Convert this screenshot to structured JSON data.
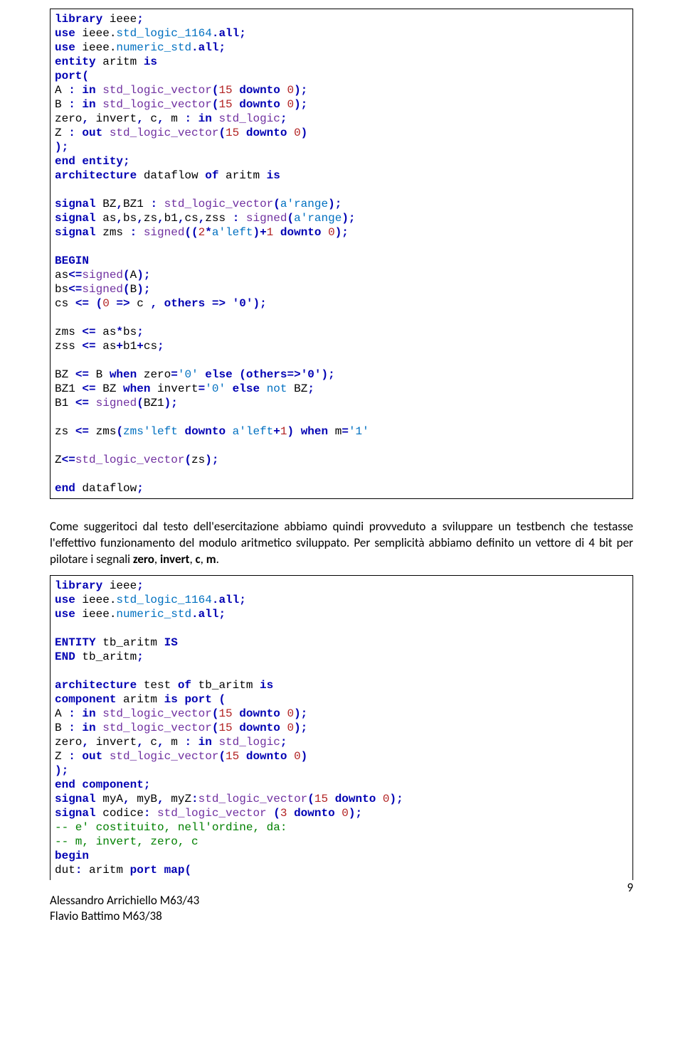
{
  "code1": {
    "l1a": "library",
    "l1b": " ieee",
    "l1c": ";",
    "l2a": "use",
    "l2b": " ieee.",
    "l2c": "std_logic_1164",
    "l2d": ".",
    "l2e": "all",
    "l2f": ";",
    "l3a": "use",
    "l3b": " ieee.",
    "l3c": "numeric_std",
    "l3d": ".",
    "l3e": "all",
    "l3f": ";",
    "l4a": "entity",
    "l4b": " aritm ",
    "l4c": "is",
    "l5a": "port",
    "l5b": "(",
    "l6a": "A ",
    "l6b": ": in ",
    "l6c": "std_logic_vector",
    "l6d": "(",
    "l6e": "15",
    "l6f": " downto ",
    "l6g": "0",
    "l6h": ");",
    "l7a": "B ",
    "l7b": ": in ",
    "l7c": "std_logic_vector",
    "l7d": "(",
    "l7e": "15",
    "l7f": " downto ",
    "l7g": "0",
    "l7h": ");",
    "l8a": "zero",
    "l8b": ", ",
    "l8c": "invert",
    "l8d": ", ",
    "l8e": "c",
    "l8f": ", ",
    "l8g": "m ",
    "l8h": ": in ",
    "l8i": "std_logic",
    "l8j": ";",
    "l9a": "Z ",
    "l9b": ": out ",
    "l9c": "std_logic_vector",
    "l9d": "(",
    "l9e": "15",
    "l9f": " downto ",
    "l9g": "0",
    "l9h": ")",
    "l10a": ");",
    "l11a": "end entity;",
    "l12a": "architecture",
    "l12b": " dataflow ",
    "l12c": "of",
    "l12d": " aritm ",
    "l12e": "is",
    "blank1": "",
    "l13a": "signal",
    "l13b": " BZ",
    "l13c": ",",
    "l13d": "BZ1 ",
    "l13e": ": ",
    "l13f": "std_logic_vector",
    "l13g": "(",
    "l13h": "a'range",
    "l13i": ");",
    "l14a": "signal",
    "l14b": " as",
    "l14c": ",",
    "l14d": "bs",
    "l14e": ",",
    "l14f": "zs",
    "l14g": ",",
    "l14h": "b1",
    "l14i": ",",
    "l14j": "cs",
    "l14k": ",",
    "l14l": "zss ",
    "l14m": ": ",
    "l14n": "signed",
    "l14o": "(",
    "l14p": "a'range",
    "l14q": ");",
    "l15a": "signal",
    "l15b": " zms ",
    "l15c": ": ",
    "l15d": "signed",
    "l15e": "((",
    "l15f": "2",
    "l15g": "*",
    "l15h": "a'left",
    "l15i": ")+",
    "l15j": "1",
    "l15k": " downto ",
    "l15l": "0",
    "l15m": ");",
    "blank2": "",
    "l16a": "BEGIN",
    "l17a": "as",
    "l17b": "<=",
    "l17c": "signed",
    "l17d": "(",
    "l17e": "A",
    "l17f": ");",
    "l18a": "bs",
    "l18b": "<=",
    "l18c": "signed",
    "l18d": "(",
    "l18e": "B",
    "l18f": ");",
    "l19a": "cs ",
    "l19b": "<= (",
    "l19c": "0",
    "l19d": " => ",
    "l19e": "c ",
    "l19f": ", others => '0');",
    "blank3": "",
    "l20a": "zms ",
    "l20b": "<= ",
    "l20c": "as",
    "l20d": "*",
    "l20e": "bs",
    "l20f": ";",
    "l21a": "zss ",
    "l21b": "<= ",
    "l21c": "as",
    "l21d": "+",
    "l21e": "b1",
    "l21f": "+",
    "l21g": "cs",
    "l21h": ";",
    "blank4": "",
    "l22a": "BZ ",
    "l22b": "<= ",
    "l22c": "B ",
    "l22d": "when",
    "l22e": " zero",
    "l22f": "=",
    "l22g": "'0'",
    "l22h": " else (others=>'0');",
    "l23a": "BZ1 ",
    "l23b": "<= ",
    "l23c": "BZ ",
    "l23d": "when",
    "l23e": " invert",
    "l23f": "=",
    "l23g": "'0'",
    "l23h": " else ",
    "l23i": "not",
    "l23j": " BZ",
    "l23k": ";",
    "l24a": "B1 ",
    "l24b": "<= ",
    "l24c": "signed",
    "l24d": "(",
    "l24e": "BZ1",
    "l24f": ");",
    "blank5": "",
    "l25a": "zs ",
    "l25b": "<= ",
    "l25c": "zms",
    "l25d": "(",
    "l25e": "zms'left",
    "l25f": " downto ",
    "l25g": "a'left",
    "l25h": "+",
    "l25i": "1",
    "l25j": ") when ",
    "l25k": "m",
    "l25l": "=",
    "l25m": "'1'",
    "blank6": "",
    "l26a": "Z",
    "l26b": "<=",
    "l26c": "std_logic_vector",
    "l26d": "(",
    "l26e": "zs",
    "l26f": ");",
    "blank7": "",
    "l27a": "end",
    "l27b": " dataflow",
    "l27c": ";"
  },
  "para": {
    "p1": "Come suggeritoci dal testo dell'esercitazione abbiamo quindi provveduto a sviluppare un testbench che testasse l'effettivo funzionamento del modulo aritmetico sviluppato. Per semplicità abbiamo definito un vettore di 4 bit per pilotare i segnali ",
    "p2": "zero",
    "p3": ", ",
    "p4": "invert",
    "p5": ", ",
    "p6": "c",
    "p7": ", ",
    "p8": "m",
    "p9": "."
  },
  "code2": {
    "l1a": "library",
    "l1b": " ieee",
    "l1c": ";",
    "l2a": "use",
    "l2b": " ieee.",
    "l2c": "std_logic_1164",
    "l2d": ".",
    "l2e": "all",
    "l2f": ";",
    "l3a": "use",
    "l3b": " ieee.",
    "l3c": "numeric_std",
    "l3d": ".",
    "l3e": "all",
    "l3f": ";",
    "blank1": "",
    "l4a": "ENTITY",
    "l4b": " tb_aritm ",
    "l4c": "IS",
    "l5a": "END",
    "l5b": " tb_aritm",
    "l5c": ";",
    "blank2": "",
    "l6a": "architecture",
    "l6b": " test ",
    "l6c": "of",
    "l6d": " tb_aritm ",
    "l6e": "is",
    "l7a": "component",
    "l7b": " aritm ",
    "l7c": "is port (",
    "l8a": "A ",
    "l8b": ": in ",
    "l8c": "std_logic_vector",
    "l8d": "(",
    "l8e": "15",
    "l8f": " downto ",
    "l8g": "0",
    "l8h": ");",
    "l9a": "B ",
    "l9b": ": in ",
    "l9c": "std_logic_vector",
    "l9d": "(",
    "l9e": "15",
    "l9f": " downto ",
    "l9g": "0",
    "l9h": ");",
    "l10a": "zero",
    "l10b": ", ",
    "l10c": "invert",
    "l10d": ", ",
    "l10e": "c",
    "l10f": ", ",
    "l10g": "m ",
    "l10h": ": in ",
    "l10i": "std_logic",
    "l10j": ";",
    "l11a": "Z ",
    "l11b": ": out ",
    "l11c": "std_logic_vector",
    "l11d": "(",
    "l11e": "15",
    "l11f": " downto ",
    "l11g": "0",
    "l11h": ")",
    "l12a": ");",
    "l13a": "end component;",
    "l14a": "signal",
    "l14b": " myA",
    "l14c": ", ",
    "l14d": "myB",
    "l14e": ", ",
    "l14f": "myZ",
    "l14g": ":",
    "l14h": "std_logic_vector",
    "l14i": "(",
    "l14j": "15",
    "l14k": " downto ",
    "l14l": "0",
    "l14m": ");",
    "l15a": "signal",
    "l15b": " codice",
    "l15c": ": ",
    "l15d": "std_logic_vector",
    "l15e": " (",
    "l15f": "3",
    "l15g": " downto ",
    "l15h": "0",
    "l15i": ");",
    "l16a": "-- e' costituito, nell'ordine, da:",
    "l17a": "-- m, invert, zero, c",
    "l18a": "begin",
    "l19a": "dut",
    "l19b": ": ",
    "l19c": "aritm ",
    "l19d": "port map("
  },
  "footer": {
    "name1": "Alessandro Arrichiello M63/43",
    "name2": "Flavio Battimo M63/38",
    "pgnum": "9"
  }
}
